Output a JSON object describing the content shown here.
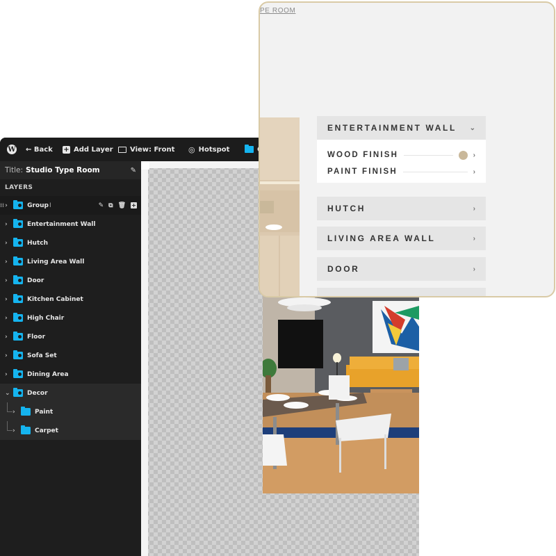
{
  "toolbar": {
    "wp_logo": "W",
    "back_label": "← Back",
    "add_layer_label": "Add Layer",
    "view_label": "View: Front",
    "hotspot_label": "Hotspot",
    "truncated_label": "C"
  },
  "sidebar": {
    "title_label": "Title:",
    "title_value": "Studio Type Room",
    "layers_heading": "LAYERS",
    "layers": [
      {
        "label": "Group",
        "chevron": "›",
        "selected": true
      },
      {
        "label": "Entertainment Wall",
        "chevron": "›"
      },
      {
        "label": "Hutch",
        "chevron": "›"
      },
      {
        "label": "Living Area Wall",
        "chevron": "›"
      },
      {
        "label": "Door",
        "chevron": "›"
      },
      {
        "label": "Kitchen Cabinet",
        "chevron": "›"
      },
      {
        "label": "High Chair",
        "chevron": "›"
      },
      {
        "label": "Floor",
        "chevron": "›"
      },
      {
        "label": "Sofa Set",
        "chevron": "›"
      },
      {
        "label": "Dining Area",
        "chevron": "›"
      },
      {
        "label": "Decor",
        "chevron": "⌄",
        "expanded": true
      },
      {
        "label": "Paint",
        "chevron": "›",
        "child": true
      },
      {
        "label": "Carpet",
        "chevron": "›",
        "child": true
      }
    ]
  },
  "popup": {
    "breadcrumb": "PE ROOM",
    "sections": [
      {
        "label": "ENTERTAINMENT WALL",
        "arrow": "⌄",
        "expanded": true,
        "options": [
          {
            "label": "WOOD FINISH",
            "swatch": "#c9b89a",
            "arrow": "›"
          },
          {
            "label": "PAINT FINISH",
            "arrow": "›"
          }
        ]
      },
      {
        "label": "HUTCH",
        "arrow": "›"
      },
      {
        "label": "LIVING AREA WALL",
        "arrow": "›"
      },
      {
        "label": "DOOR",
        "arrow": "›"
      }
    ]
  },
  "colors": {
    "editor_bg": "#1c1c1c",
    "folder_accent": "#15b4ef",
    "popup_border": "#d9caa6",
    "popup_bg": "#f2f2f2",
    "section_bg": "#e5e5e5"
  }
}
